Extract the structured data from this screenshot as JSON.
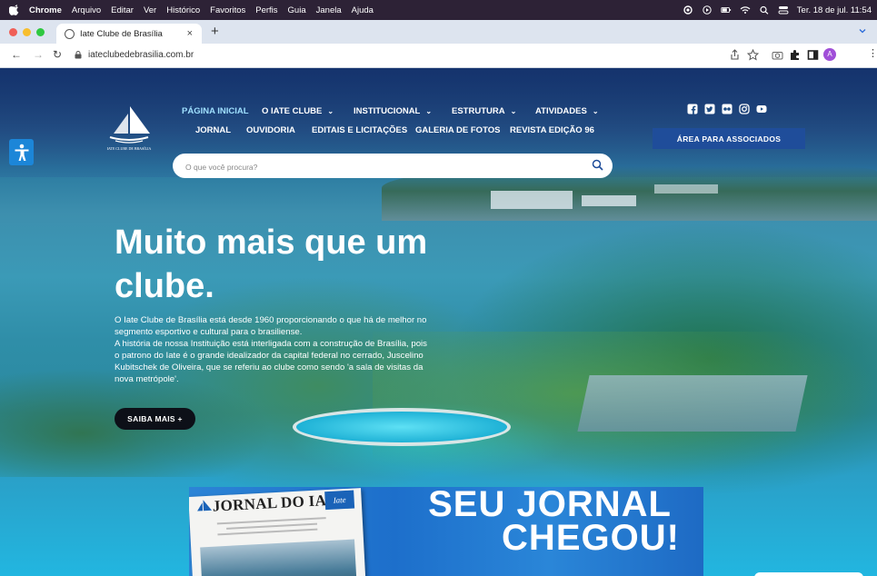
{
  "menubar": {
    "app": "Chrome",
    "items": [
      "Arquivo",
      "Editar",
      "Ver",
      "Histórico",
      "Favoritos",
      "Perfis",
      "Guia",
      "Janela",
      "Ajuda"
    ],
    "clock": "Ter. 18 de jul. 11:54"
  },
  "browser": {
    "tab_title": "Iate Clube de Brasília",
    "tab_close": "×",
    "new_tab": "+",
    "url": "iateclubedebrasilia.com.br",
    "profile_initial": "A"
  },
  "site": {
    "logo_caption": "IATE CLUBE DE BRASÍLIA",
    "nav_row1": [
      {
        "label": "PÁGINA INICIAL",
        "dropdown": false
      },
      {
        "label": "O IATE CLUBE",
        "dropdown": true
      },
      {
        "label": "INSTITUCIONAL",
        "dropdown": true
      },
      {
        "label": "ESTRUTURA",
        "dropdown": true
      },
      {
        "label": "ATIVIDADES",
        "dropdown": true
      }
    ],
    "nav_row2": [
      "JORNAL",
      "OUVIDORIA",
      "EDITAIS E LICITAÇÕES",
      "GALERIA DE FOTOS",
      "REVISTA EDIÇÃO 96"
    ],
    "members_button": "ÁREA PARA ASSOCIADOS",
    "search_placeholder": "O que você procura?",
    "headline": "Muito mais que um clube.",
    "description_p1": "O Iate Clube de Brasília está desde 1960 proporcionando o que há de melhor no segmento esportivo e cultural para o brasiliense.",
    "description_p2": "A história de nossa Instituição está interligada com a construção de Brasília, pois o patrono do Iate é o grande idealizador da capital federal no cerrado, Juscelino Kubitschek de Oliveira, que se referiu ao clube como sendo 'a sala de visitas da nova metrópole'.",
    "cta": "SAIBA MAIS +",
    "banner": {
      "paper_title": "JORNAL DO IATE",
      "paper_mast": "Iate",
      "line1": "SEU JORNAL",
      "line2": "CHEGOU!"
    }
  },
  "colors": {
    "menubar": "#2d2236",
    "members_button": "#1f4d9a",
    "cta": "#0d1018",
    "accessibility": "#1c86d8",
    "banner": "#2c84d6"
  }
}
